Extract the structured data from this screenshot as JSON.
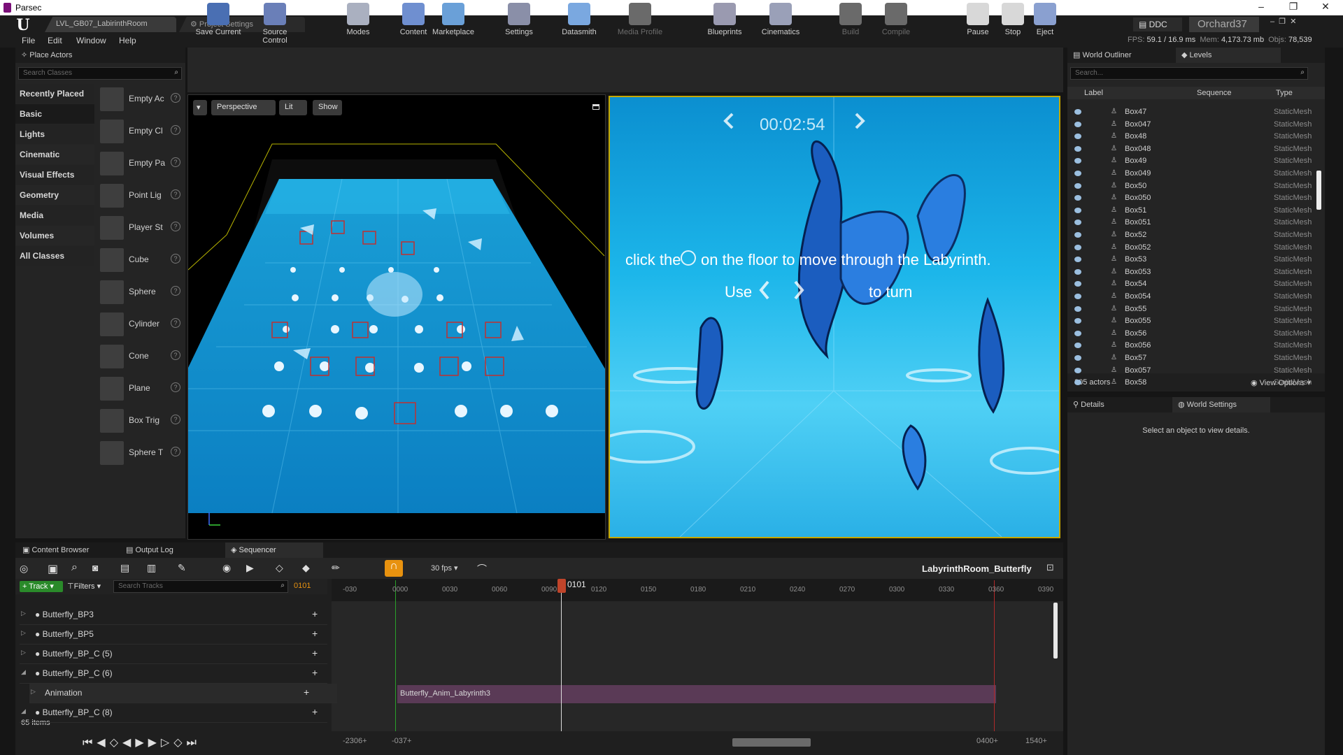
{
  "parsec": {
    "title": "Parsec"
  },
  "tabs": {
    "level": "LVL_GB07_LabirinthRoom",
    "settings": "Project Settings"
  },
  "menu": [
    "File",
    "Edit",
    "Window",
    "Help"
  ],
  "stats": {
    "fps_label": "FPS:",
    "fps": "59.1",
    "frame": "/ 16.9 ms",
    "mem_label": "Mem:",
    "mem": "4,173.73 mb",
    "objs_label": "Objs:",
    "objs": "78,539",
    "ddc": "DDC",
    "user": "Orchard37"
  },
  "place": {
    "title": "Place Actors",
    "search_placeholder": "Search Classes",
    "categories": [
      "Recently Placed",
      "Basic",
      "Lights",
      "Cinematic",
      "Visual Effects",
      "Geometry",
      "Media",
      "Volumes",
      "All Classes"
    ],
    "actors": [
      "Empty Ac",
      "Empty Cl",
      "Empty Pa",
      "Point Lig",
      "Player St",
      "Cube",
      "Sphere",
      "Cylinder",
      "Cone",
      "Plane",
      "Box Trig",
      "Sphere T"
    ]
  },
  "toolbar": {
    "items": [
      "Save Current",
      "Source Control",
      "Modes",
      "Content",
      "Marketplace",
      "Settings",
      "Datasmith",
      "Media Profile",
      "Blueprints",
      "Cinematics",
      "Build",
      "Compile",
      "Pause",
      "Stop",
      "Eject"
    ]
  },
  "viewport": {
    "perspective": "Perspective",
    "lit": "Lit",
    "show": "Show"
  },
  "game": {
    "timer": "00:02:54",
    "line1a": "click the",
    "line1b": "on the floor to move through the Labyrinth.",
    "line2a": "Use",
    "line2b": "to turn"
  },
  "outliner": {
    "title": "World Outliner",
    "levels": "Levels",
    "search_placeholder": "Search...",
    "col_label": "Label",
    "col_seq": "Sequence",
    "col_type": "Type",
    "rows": [
      "Box47",
      "Box047",
      "Box48",
      "Box048",
      "Box49",
      "Box049",
      "Box50",
      "Box050",
      "Box51",
      "Box051",
      "Box52",
      "Box052",
      "Box53",
      "Box053",
      "Box54",
      "Box054",
      "Box55",
      "Box055",
      "Box56",
      "Box056",
      "Box57",
      "Box057",
      "Box58"
    ],
    "type": "StaticMesh",
    "count": "305 actors",
    "view_options": "View Options"
  },
  "details": {
    "title": "Details",
    "world": "World Settings",
    "empty": "Select an object to view details."
  },
  "sequencer": {
    "tabs": [
      "Content Browser",
      "Output Log",
      "Sequencer"
    ],
    "fps": "30 fps",
    "name": "LabyrinthRoom_Butterfly",
    "track": "Track",
    "filters": "Filters",
    "search_placeholder": "Search Tracks",
    "frame": "0101",
    "playhead": "0101",
    "rows": [
      "Butterfly_BP3",
      "Butterfly_BP5",
      "Butterfly_BP_C (5)",
      "Butterfly_BP_C (6)",
      "Animation",
      "Butterfly_BP_C (8)"
    ],
    "count": "65 items",
    "clip": "Butterfly_Anim_Labyrinth3",
    "ticks": [
      "-030",
      "0000",
      "0030",
      "0060",
      "0090",
      "0120",
      "0150",
      "0180",
      "0210",
      "0240",
      "0270",
      "0300",
      "0330",
      "0360",
      "0390"
    ],
    "range_start": "-2306+",
    "range_start2": "-037+",
    "range_end": "0400+",
    "range_end2": "1540+"
  }
}
